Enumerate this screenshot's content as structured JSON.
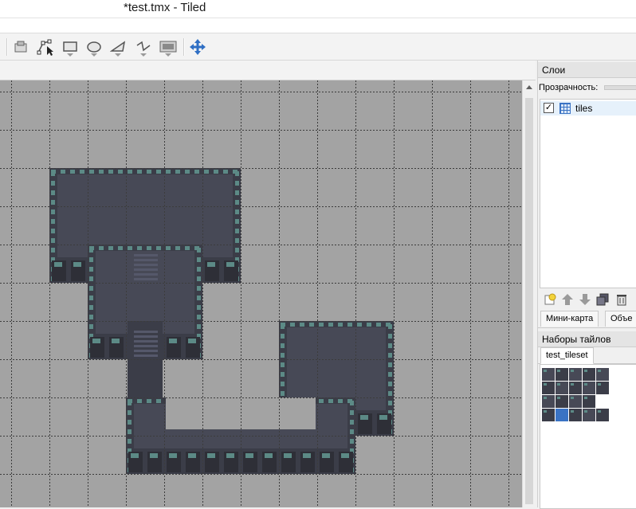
{
  "window": {
    "title": "*test.tmx - Tiled"
  },
  "toolbar": {
    "tools": [
      {
        "name": "select-objects-icon"
      },
      {
        "name": "edit-polygons-icon"
      },
      {
        "name": "insert-rectangle-icon"
      },
      {
        "name": "insert-ellipse-icon"
      },
      {
        "name": "insert-polygon-icon"
      },
      {
        "name": "insert-polyline-icon"
      },
      {
        "name": "insert-tile-icon"
      },
      {
        "name": "move-icon"
      }
    ]
  },
  "layers_panel": {
    "title": "Слои",
    "opacity_label": "Прозрачность:",
    "layers": [
      {
        "name": "tiles",
        "visible": true,
        "selected": true
      }
    ],
    "buttons": [
      "new-layer-icon",
      "raise-layer-icon",
      "lower-layer-icon",
      "duplicate-layer-icon",
      "delete-layer-icon"
    ]
  },
  "bottom_tabs": {
    "minimap": "Мини-карта",
    "objects": "Объе"
  },
  "tilesets_panel": {
    "title": "Наборы тайлов",
    "tab": "test_tileset"
  },
  "colors": {
    "map_bg": "#a3a3a3",
    "wall_dark": "#2e2f37",
    "wall_mid": "#3b3d48",
    "floor": "#474956",
    "moss": "#5c8a86",
    "selection": "#3a73c4"
  }
}
